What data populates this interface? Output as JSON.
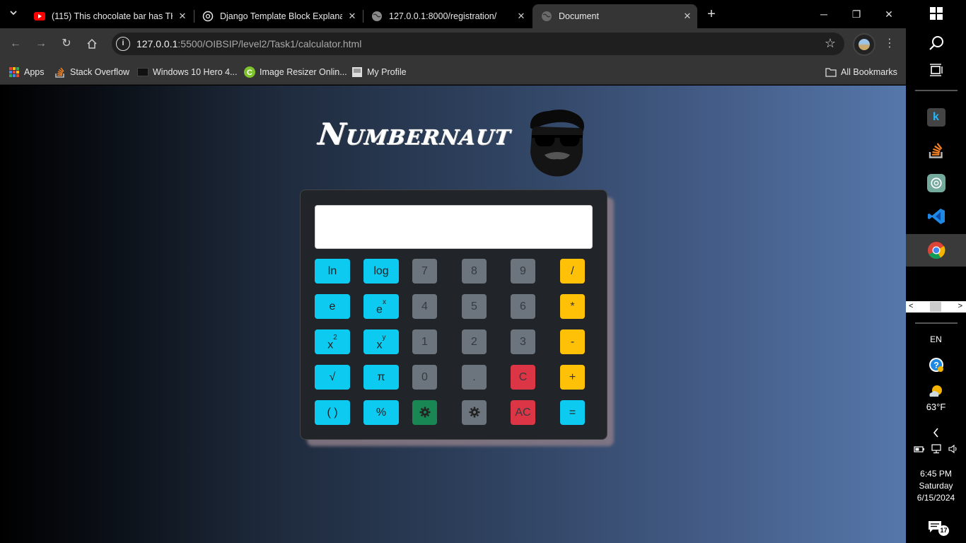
{
  "tabs": [
    {
      "title": "(115) This chocolate bar has THE",
      "favicon": "youtube-icon",
      "active": false
    },
    {
      "title": "Django Template Block Explanat",
      "favicon": "chatgpt-icon",
      "active": false
    },
    {
      "title": "127.0.0.1:8000/registration/",
      "favicon": "globe-icon",
      "active": false
    },
    {
      "title": "Document",
      "favicon": "globe-icon",
      "active": true
    }
  ],
  "address": {
    "host": "127.0.0.1",
    "path": ":5500/OIBSIP/level2/Task1/calculator.html"
  },
  "bookmarks": [
    {
      "label": "Apps",
      "icon": "apps-grid-icon"
    },
    {
      "label": "Stack Overflow",
      "icon": "stackoverflow-icon"
    },
    {
      "label": "Windows 10 Hero 4...",
      "icon": "image-icon"
    },
    {
      "label": "Image Resizer Onlin...",
      "icon": "resizer-icon"
    },
    {
      "label": "My Profile",
      "icon": "profile-page-icon"
    }
  ],
  "all_bookmarks": "All Bookmarks",
  "app": {
    "logo_text": "Numbernaut",
    "display_value": "",
    "rows": [
      [
        "ln",
        "log",
        "7",
        "8",
        "9",
        "/"
      ],
      [
        "e",
        "e^x",
        "4",
        "5",
        "6",
        "*"
      ],
      [
        "x^2",
        "x^y",
        "1",
        "2",
        "3",
        "-"
      ],
      [
        "√",
        "π",
        "0",
        ".",
        "C",
        "+"
      ],
      [
        "( )",
        "%",
        "⚙",
        "⚙",
        "AC",
        "="
      ]
    ],
    "labels": {
      "ln": "ln",
      "log": "log",
      "e": "e",
      "ex_base": "e",
      "ex_sup": "x",
      "x2_base": "x",
      "x2_sup": "2",
      "xy_base": "x",
      "xy_sup": "y",
      "sqrt": "√",
      "pi": "π",
      "paren": "( )",
      "percent": "%",
      "n7": "7",
      "n8": "8",
      "n9": "9",
      "n4": "4",
      "n5": "5",
      "n6": "6",
      "n1": "1",
      "n2": "2",
      "n3": "3",
      "n0": "0",
      "dot": ".",
      "clear": "C",
      "all_clear": "AC",
      "div": "/",
      "mul": "*",
      "sub": "-",
      "add": "+",
      "eq": "="
    },
    "colors": {
      "info": "#0dcaf0",
      "secondary": "#6c757d",
      "warning": "#ffc107",
      "danger": "#dc3545",
      "success": "#198754"
    }
  },
  "taskbar": {
    "language": "EN",
    "weather_temp": "63°F",
    "time": "6:45 PM",
    "day": "Saturday",
    "date": "6/15/2024",
    "notifications": "17"
  }
}
